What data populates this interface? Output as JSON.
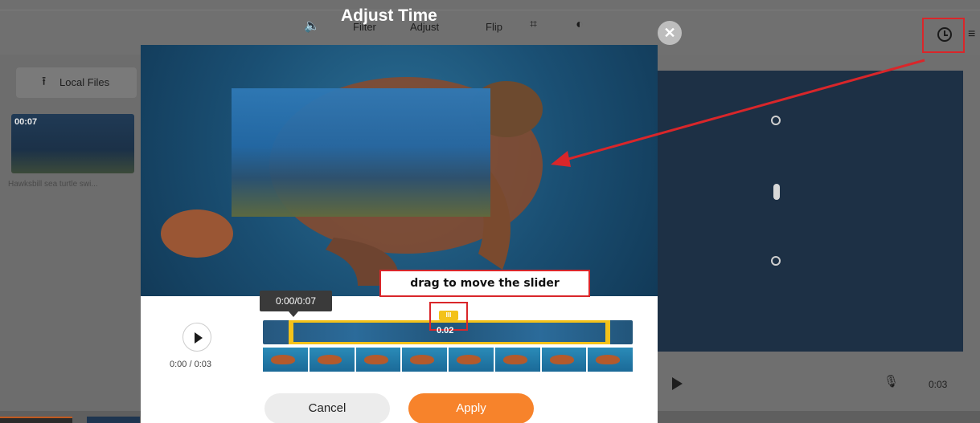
{
  "header": {
    "title": "Adjust Time",
    "close_glyph": "✕",
    "tools": [
      {
        "name": "volume-icon",
        "glyph": "🔈"
      },
      {
        "label": "Filter"
      },
      {
        "label": "Adjust"
      },
      {
        "label": "Flip"
      },
      {
        "name": "crop-icon",
        "glyph": "⌗"
      },
      {
        "name": "color-icon",
        "glyph": "◐"
      }
    ],
    "clock_icon": "clock-icon",
    "layers_icon": "layers-icon"
  },
  "sidebar": {
    "local_files_label": "Local Files",
    "upload_glyph": "⭱",
    "media": [
      {
        "duration": "00:07",
        "caption": "Hawksbill sea turtle swi..."
      }
    ]
  },
  "modal": {
    "time_tooltip": "0:00/0:07",
    "annotation": "drag to move the slider",
    "slider_knob": "III",
    "slider_value": "0.02",
    "playback_time": "0:00 / 0:03",
    "cancel_label": "Cancel",
    "apply_label": "Apply"
  },
  "player": {
    "time": "0:03"
  },
  "colors": {
    "accent": "#f7832b",
    "highlight": "#d9262a",
    "trim": "#f3c21a"
  }
}
